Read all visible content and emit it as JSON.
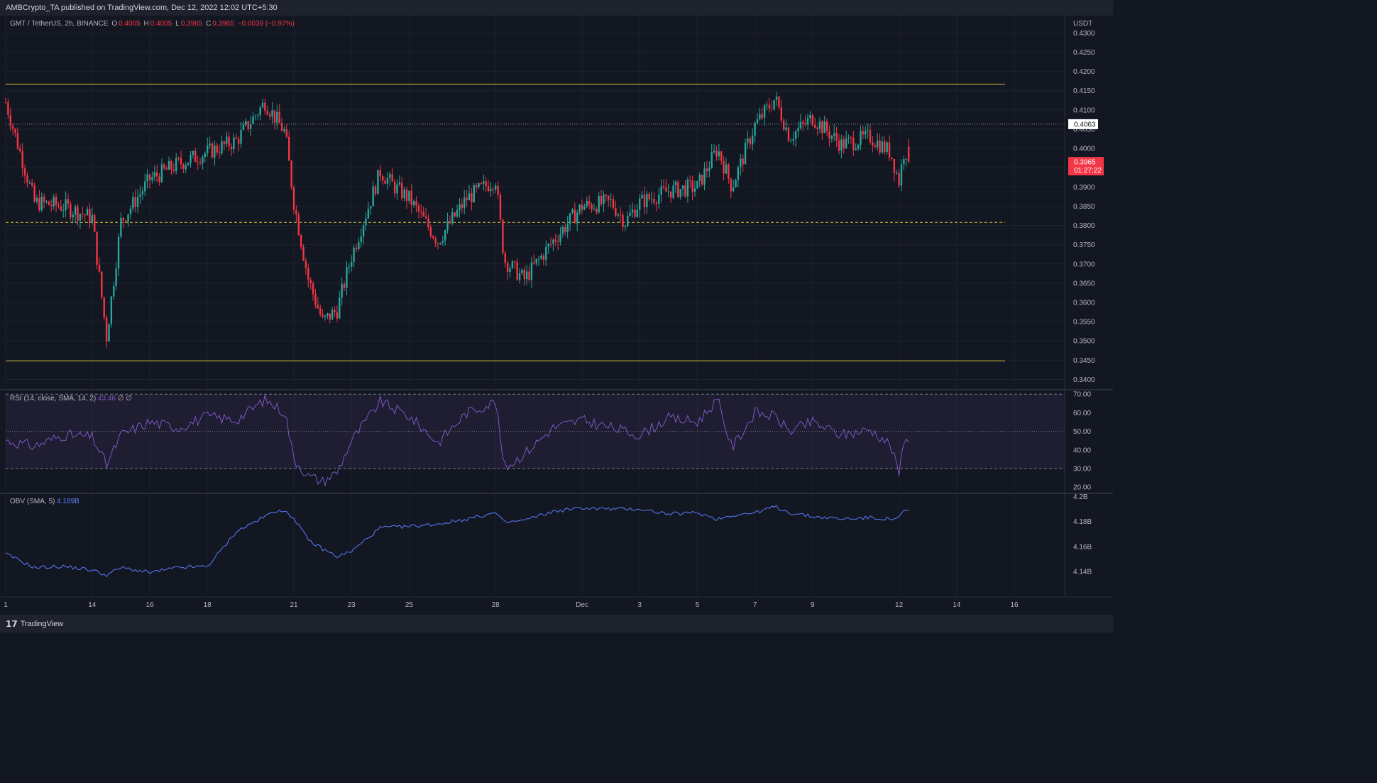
{
  "header": {
    "published": "AMBCrypto_TA published on TradingView.com, Dec 12, 2022 12:02 UTC+5:30"
  },
  "legend": {
    "symbol": "GMT / TetherUS, 2h, BINANCE",
    "o_label": "O",
    "o": "0.4005",
    "h_label": "H",
    "h": "0.4005",
    "l_label": "L",
    "l": "0.3965",
    "c_label": "C",
    "c": "0.3965",
    "change": "−0.0039 (−0.97%)"
  },
  "rsi_legend": {
    "label": "RSI (14, close, SMA, 14, 2)",
    "value": "43.46",
    "extra": "∅ ∅"
  },
  "obv_legend": {
    "label": "OBV (SMA, 5)",
    "value": "4.189B"
  },
  "footer": {
    "brand": "TradingView"
  },
  "colors": {
    "up": "#26a69a",
    "down": "#f23645",
    "level": "#d4c338",
    "rsi": "#7e57c2",
    "obv": "#5b7cff",
    "bg": "#131722"
  },
  "chart_data": [
    {
      "type": "candlestick",
      "title": "GMT / TetherUS, 2h, BINANCE",
      "price_axis": {
        "unit": "USDT",
        "ticks": [
          "0.4300",
          "0.4250",
          "0.4200",
          "0.4150",
          "0.4100",
          "0.4050",
          "0.4000",
          "0.3950",
          "0.3900",
          "0.3850",
          "0.3800",
          "0.3750",
          "0.3700",
          "0.3650",
          "0.3600",
          "0.3550",
          "0.3500",
          "0.3450",
          "0.3400"
        ],
        "ylim": [
          0.3375,
          0.4345
        ]
      },
      "time_axis": {
        "ticks": [
          "1",
          "14",
          "16",
          "18",
          "21",
          "23",
          "25",
          "28",
          "Dec",
          "3",
          "5",
          "7",
          "9",
          "12",
          "14",
          "16"
        ],
        "tick_days": [
          0,
          3,
          5,
          7,
          10,
          12,
          14,
          17,
          20,
          22,
          24,
          26,
          28,
          31,
          33,
          35
        ]
      },
      "levels": [
        {
          "name": "range-high",
          "price": 0.4167,
          "style": "solid"
        },
        {
          "name": "mid-range",
          "price": 0.3808,
          "style": "dashed"
        },
        {
          "name": "range-low",
          "price": 0.3448,
          "style": "solid"
        }
      ],
      "price_labels": [
        {
          "price": 0.4063,
          "text": "0.4063",
          "kind": "prev"
        },
        {
          "price": 0.3965,
          "text": "0.3965",
          "countdown": "01:27:22",
          "kind": "last"
        }
      ],
      "key_closes": [
        {
          "day": 0,
          "close": 0.412
        },
        {
          "day": 1,
          "close": 0.386
        },
        {
          "day": 2,
          "close": 0.385
        },
        {
          "day": 3,
          "close": 0.382
        },
        {
          "day": 3.5,
          "close": 0.351
        },
        {
          "day": 4,
          "close": 0.381
        },
        {
          "day": 5,
          "close": 0.392
        },
        {
          "day": 6,
          "close": 0.396
        },
        {
          "day": 7,
          "close": 0.399
        },
        {
          "day": 8,
          "close": 0.402
        },
        {
          "day": 9,
          "close": 0.412
        },
        {
          "day": 9.7,
          "close": 0.404
        },
        {
          "day": 10,
          "close": 0.386
        },
        {
          "day": 10.5,
          "close": 0.366
        },
        {
          "day": 11,
          "close": 0.355
        },
        {
          "day": 11.5,
          "close": 0.358
        },
        {
          "day": 12,
          "close": 0.372
        },
        {
          "day": 13,
          "close": 0.394
        },
        {
          "day": 13.5,
          "close": 0.39
        },
        {
          "day": 14,
          "close": 0.387
        },
        {
          "day": 15,
          "close": 0.376
        },
        {
          "day": 16,
          "close": 0.387
        },
        {
          "day": 17,
          "close": 0.392
        },
        {
          "day": 17.3,
          "close": 0.371
        },
        {
          "day": 18,
          "close": 0.366
        },
        {
          "day": 19,
          "close": 0.376
        },
        {
          "day": 20,
          "close": 0.385
        },
        {
          "day": 21,
          "close": 0.386
        },
        {
          "day": 21.5,
          "close": 0.381
        },
        {
          "day": 22,
          "close": 0.386
        },
        {
          "day": 23,
          "close": 0.389
        },
        {
          "day": 24,
          "close": 0.39
        },
        {
          "day": 24.7,
          "close": 0.4
        },
        {
          "day": 25.2,
          "close": 0.39
        },
        {
          "day": 26,
          "close": 0.406
        },
        {
          "day": 26.7,
          "close": 0.413
        },
        {
          "day": 27.2,
          "close": 0.403
        },
        {
          "day": 28,
          "close": 0.408
        },
        {
          "day": 29,
          "close": 0.401
        },
        {
          "day": 30,
          "close": 0.403
        },
        {
          "day": 30.7,
          "close": 0.399
        },
        {
          "day": 31,
          "close": 0.3915
        },
        {
          "day": 31.2,
          "close": 0.4005
        },
        {
          "day": 31.35,
          "close": 0.3965
        }
      ]
    },
    {
      "type": "line",
      "title": "RSI (14, close, SMA, 14, 2)",
      "ticks": [
        "70.00",
        "60.00",
        "50.00",
        "40.00",
        "30.00",
        "20.00"
      ],
      "ylim": [
        17,
        72
      ],
      "bands": [
        70,
        50,
        30
      ],
      "key_values": [
        {
          "day": 0,
          "v": 45
        },
        {
          "day": 1,
          "v": 42
        },
        {
          "day": 2,
          "v": 48
        },
        {
          "day": 3,
          "v": 47
        },
        {
          "day": 3.5,
          "v": 32
        },
        {
          "day": 4,
          "v": 48
        },
        {
          "day": 5,
          "v": 55
        },
        {
          "day": 6,
          "v": 52
        },
        {
          "day": 7,
          "v": 58
        },
        {
          "day": 8,
          "v": 56
        },
        {
          "day": 9,
          "v": 67
        },
        {
          "day": 9.7,
          "v": 60
        },
        {
          "day": 10,
          "v": 35
        },
        {
          "day": 10.5,
          "v": 26
        },
        {
          "day": 11,
          "v": 23
        },
        {
          "day": 11.5,
          "v": 28
        },
        {
          "day": 12,
          "v": 45
        },
        {
          "day": 13,
          "v": 66
        },
        {
          "day": 14,
          "v": 58
        },
        {
          "day": 15,
          "v": 44
        },
        {
          "day": 16,
          "v": 60
        },
        {
          "day": 17,
          "v": 66
        },
        {
          "day": 17.3,
          "v": 30
        },
        {
          "day": 18,
          "v": 38
        },
        {
          "day": 19,
          "v": 52
        },
        {
          "day": 20,
          "v": 56
        },
        {
          "day": 21,
          "v": 52
        },
        {
          "day": 22,
          "v": 48
        },
        {
          "day": 23,
          "v": 57
        },
        {
          "day": 24,
          "v": 55
        },
        {
          "day": 24.7,
          "v": 67
        },
        {
          "day": 25.2,
          "v": 41
        },
        {
          "day": 26,
          "v": 60
        },
        {
          "day": 26.7,
          "v": 58
        },
        {
          "day": 27.2,
          "v": 50
        },
        {
          "day": 28,
          "v": 55
        },
        {
          "day": 29,
          "v": 48
        },
        {
          "day": 30,
          "v": 51
        },
        {
          "day": 30.7,
          "v": 43
        },
        {
          "day": 31,
          "v": 27
        },
        {
          "day": 31.2,
          "v": 50
        },
        {
          "day": 31.35,
          "v": 43.46
        }
      ]
    },
    {
      "type": "line",
      "title": "OBV (SMA, 5)",
      "ticks": [
        "4.2B",
        "4.18B",
        "4.16B",
        "4.14B"
      ],
      "ylim": [
        4.12,
        4.202
      ],
      "key_values": [
        {
          "day": 0,
          "v": 4.154
        },
        {
          "day": 1,
          "v": 4.143
        },
        {
          "day": 2,
          "v": 4.144
        },
        {
          "day": 3,
          "v": 4.141
        },
        {
          "day": 3.5,
          "v": 4.137
        },
        {
          "day": 4,
          "v": 4.143
        },
        {
          "day": 5,
          "v": 4.139
        },
        {
          "day": 6,
          "v": 4.143
        },
        {
          "day": 7,
          "v": 4.144
        },
        {
          "day": 7.7,
          "v": 4.163
        },
        {
          "day": 8,
          "v": 4.172
        },
        {
          "day": 9,
          "v": 4.184
        },
        {
          "day": 9.5,
          "v": 4.19
        },
        {
          "day": 10,
          "v": 4.183
        },
        {
          "day": 10.5,
          "v": 4.165
        },
        {
          "day": 11,
          "v": 4.158
        },
        {
          "day": 11.5,
          "v": 4.152
        },
        {
          "day": 12,
          "v": 4.156
        },
        {
          "day": 13,
          "v": 4.175
        },
        {
          "day": 14,
          "v": 4.176
        },
        {
          "day": 15,
          "v": 4.178
        },
        {
          "day": 16,
          "v": 4.182
        },
        {
          "day": 17,
          "v": 4.187
        },
        {
          "day": 17.3,
          "v": 4.179
        },
        {
          "day": 18,
          "v": 4.181
        },
        {
          "day": 19,
          "v": 4.188
        },
        {
          "day": 20,
          "v": 4.191
        },
        {
          "day": 21,
          "v": 4.19
        },
        {
          "day": 22,
          "v": 4.19
        },
        {
          "day": 23,
          "v": 4.186
        },
        {
          "day": 24,
          "v": 4.187
        },
        {
          "day": 24.7,
          "v": 4.182
        },
        {
          "day": 25.2,
          "v": 4.185
        },
        {
          "day": 26,
          "v": 4.187
        },
        {
          "day": 26.7,
          "v": 4.192
        },
        {
          "day": 27.2,
          "v": 4.187
        },
        {
          "day": 28,
          "v": 4.184
        },
        {
          "day": 29,
          "v": 4.182
        },
        {
          "day": 30,
          "v": 4.183
        },
        {
          "day": 30.7,
          "v": 4.182
        },
        {
          "day": 31,
          "v": 4.183
        },
        {
          "day": 31.2,
          "v": 4.189
        },
        {
          "day": 31.35,
          "v": 4.189
        }
      ]
    }
  ]
}
